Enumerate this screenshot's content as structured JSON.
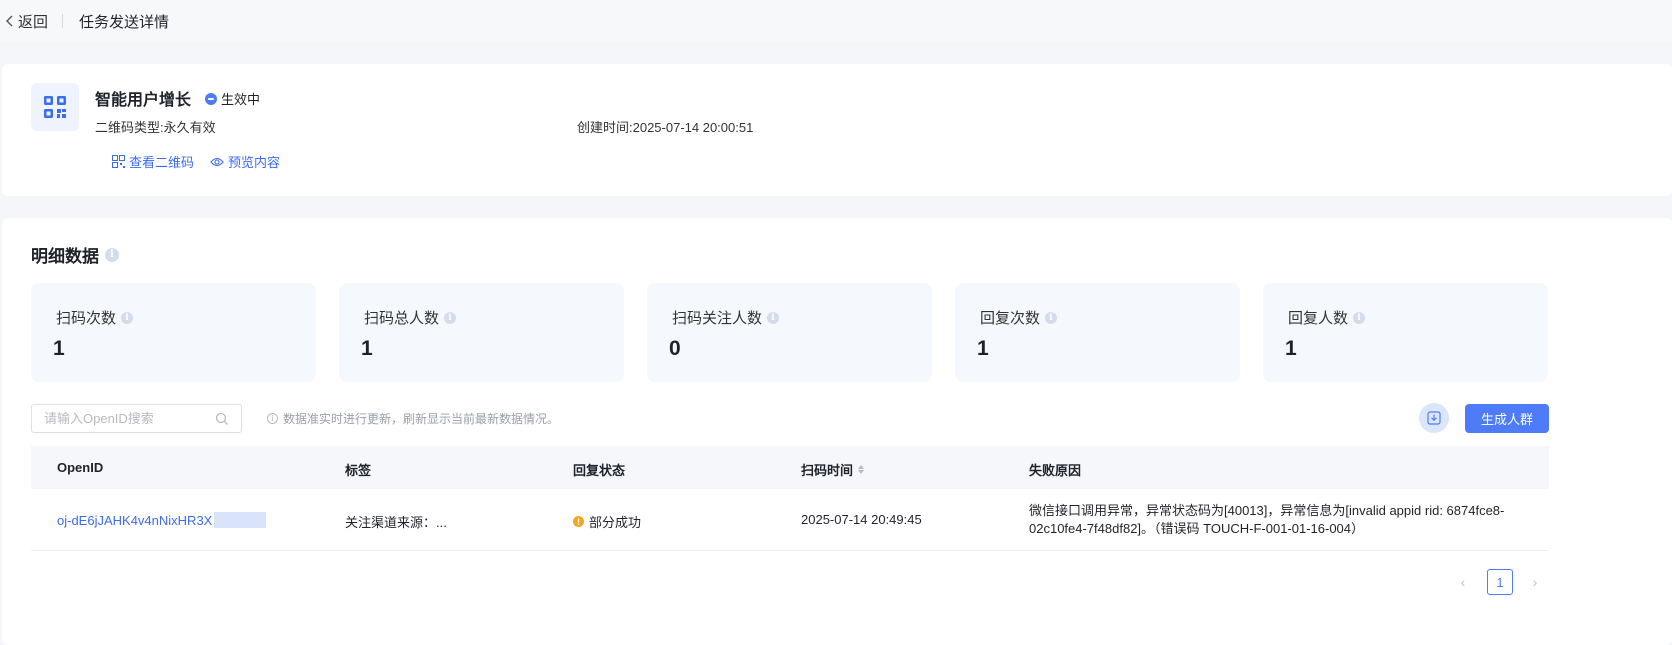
{
  "topbar": {
    "back_label": "返回",
    "page_title": "任务发送详情"
  },
  "task": {
    "name": "智能用户增长",
    "status": "生效中",
    "qr_type": "二维码类型:永久有效",
    "created_at": "创建时间:2025-07-14 20:00:51",
    "view_qr_label": "查看二维码",
    "preview_label": "预览内容"
  },
  "detail": {
    "title": "明细数据",
    "stats": [
      {
        "label": "扫码次数",
        "value": "1"
      },
      {
        "label": "扫码总人数",
        "value": "1"
      },
      {
        "label": "扫码关注人数",
        "value": "0"
      },
      {
        "label": "回复次数",
        "value": "1"
      },
      {
        "label": "回复人数",
        "value": "1"
      }
    ],
    "search_placeholder": "请输入OpenID搜索",
    "notice": "数据准实时进行更新，刷新显示当前最新数据情况。",
    "generate_label": "生成人群"
  },
  "table": {
    "columns": [
      "OpenID",
      "标签",
      "回复状态",
      "扫码时间",
      "失败原因"
    ],
    "rows": [
      {
        "openid": "oj-dE6jJAHK4v4nNixHR3X",
        "tag": "关注渠道来源：...",
        "reply_status": "部分成功",
        "scan_time": "2025-07-14 20:49:45",
        "fail_reason": "微信接口调用异常，异常状态码为[40013]，异常信息为[invalid appid rid: 6874fce8-02c10fe4-7f48df82]。（错误码 TOUCH-F-001-01-16-004）"
      }
    ]
  },
  "pagination": {
    "current_page": "1",
    "prev": "‹",
    "next": "›"
  },
  "colors": {
    "accent": "#4e7bf7",
    "link": "#3c6cf0",
    "warning": "#f5a623"
  }
}
